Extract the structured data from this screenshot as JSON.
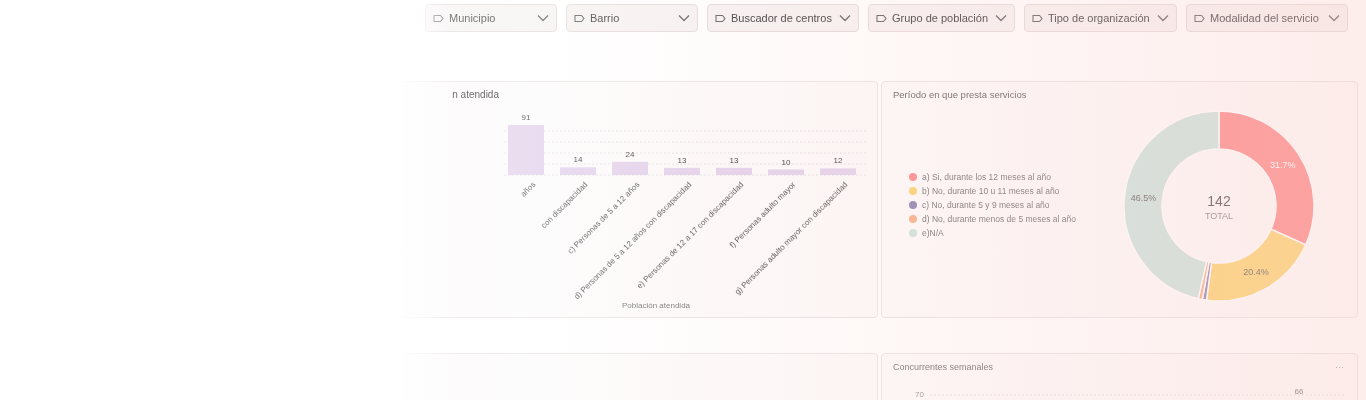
{
  "filters": [
    {
      "label": "Municipio"
    },
    {
      "label": "Barrio"
    },
    {
      "label": "Buscador de centros"
    },
    {
      "label": "Grupo de población"
    },
    {
      "label": "Tipo de organización"
    },
    {
      "label": "Modalidad del servicio"
    }
  ],
  "population_chart": {
    "chart_data": {
      "type": "bar",
      "title": "n atendida",
      "xlabel": "Población atendida",
      "categories": [
        "años",
        "con discapacidad",
        "c) Personas de 5 a 12 años",
        "d) Personas de 5 a 12 años con discapacidad",
        "e) Personas de 12 a 17 con discapacidad",
        "f) Personas adulto mayor",
        "g) Personas adulto mayor con discapacidad"
      ],
      "series": [
        {
          "color": "#e4d3ec",
          "values": [
            91,
            14,
            24,
            13,
            13,
            10,
            12
          ]
        }
      ],
      "data_labels": true
    }
  },
  "period_chart": {
    "chart_data": {
      "type": "donut",
      "title": "Período en que presta servicios",
      "categories": [
        "a) Si, durante los 12 meses al año",
        "b) No, durante 10 u 11 meses al año",
        "c) No, durante 5 y 9 meses al año",
        "d) No, durante menos de 5 meses al año",
        "e)N/A"
      ],
      "series": [
        {
          "values": [
            31.7,
            20.4,
            0.7,
            0.7,
            46.5
          ]
        }
      ],
      "legend": "left",
      "colors": [
        "#fc8e8e",
        "#fcd476",
        "#8f86b6",
        "#f8b28c",
        "#cde4df"
      ],
      "value_labels": [
        "31.7%",
        "20.4%",
        null,
        null,
        "46.5%"
      ],
      "annotations": [
        {
          "text": "142"
        },
        {
          "text": "TOTAL"
        }
      ]
    }
  },
  "weekly_chart": {
    "title": "Concurrentes semanales",
    "menu": "···",
    "y_tick": "70",
    "bar_label": "66"
  }
}
